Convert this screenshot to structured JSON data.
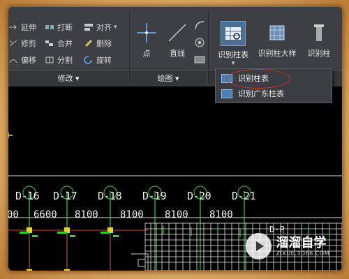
{
  "modify_panel": {
    "items": [
      {
        "label": "延伸",
        "icon": "extend-icon"
      },
      {
        "label": "打断",
        "icon": "break-icon"
      },
      {
        "label": "对齐",
        "icon": "align-icon"
      },
      {
        "label": "修剪",
        "icon": "trim-icon"
      },
      {
        "label": "合并",
        "icon": "join-icon"
      },
      {
        "label": "删除",
        "icon": "erase-icon"
      },
      {
        "label": "偏移",
        "icon": "offset-icon"
      },
      {
        "label": "分割",
        "icon": "split-icon"
      },
      {
        "label": "旋转",
        "icon": "rotate-icon"
      }
    ],
    "title": "修改 ▾"
  },
  "draw_panel": {
    "point_label": "点",
    "line_label": "直线",
    "title": "绘图 ▾"
  },
  "recognize_panel": {
    "column_table_label": "识别柱表",
    "column_detail_label": "识别柱大样",
    "column_label": "识别柱"
  },
  "dropdown": {
    "items": [
      "识别柱表",
      "识别广东柱表"
    ]
  },
  "drawing": {
    "axis_labels": [
      "D-16",
      "D-17",
      "D-18",
      "D-19",
      "D-20",
      "D-21"
    ],
    "dimensions": [
      "00",
      "6600",
      "8100",
      "8100",
      "8100",
      "8100"
    ],
    "partial_label": "D-P"
  },
  "watermark": {
    "title": "溜溜自学",
    "subtitle": "ZIXUE.3D66.COM"
  },
  "colors": {
    "ribbon_bg": "#3d3f44",
    "canvas_bg": "#000000",
    "axis_green": "#2fd13b",
    "grid_red": "#d23a3a",
    "highlight_red": "#c0392b"
  }
}
